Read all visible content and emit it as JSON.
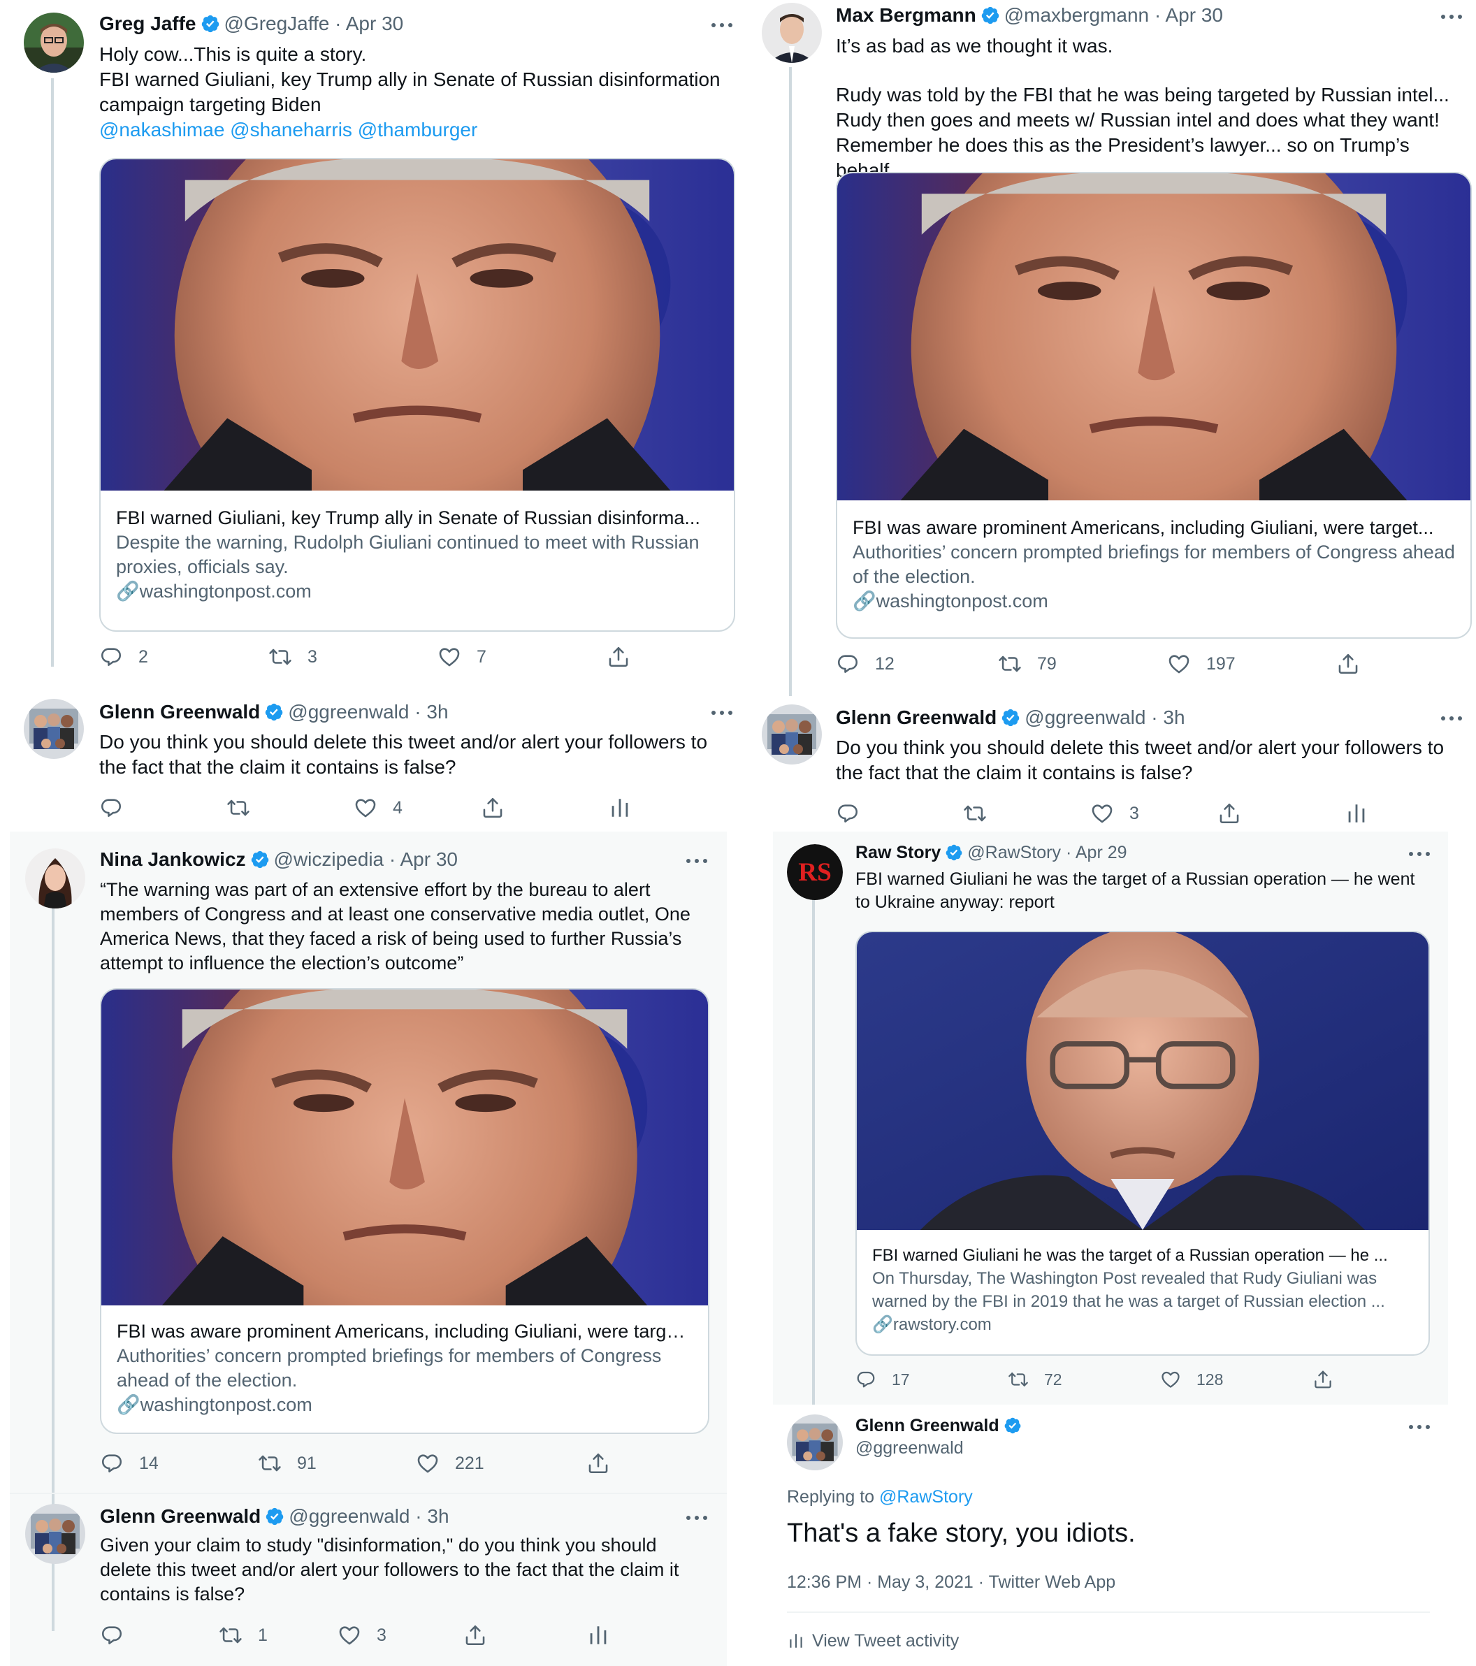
{
  "panels": {
    "top_left": {
      "original": {
        "name": "Greg Jaffe",
        "handle": "@GregJaffe",
        "time": "· Apr 30",
        "text_line1": "Holy cow...This is quite a story.",
        "text_line2": "FBI warned Giuliani, key Trump ally in Senate of Russian disinformation campaign targeting Biden",
        "mentions": "@nakashimae @shaneharris @thamburger",
        "card": {
          "title": "FBI warned Giuliani, key Trump ally in Senate of Russian disinforma...",
          "desc": "Despite the warning, Rudolph Giuliani continued to meet with Russian proxies, officials say.",
          "domain": "washingtonpost.com"
        },
        "replies": "2",
        "retweets": "3",
        "likes": "7"
      },
      "reply": {
        "name": "Glenn Greenwald",
        "handle": "@ggreenwald",
        "time": "· 3h",
        "text": "Do you think you should delete this tweet and/or alert your followers to the fact that the claim it contains is false?",
        "likes": "4"
      }
    },
    "top_right": {
      "original": {
        "name": "Max Bergmann",
        "handle": "@maxbergmann",
        "time": "· Apr 30",
        "text_line1": "It’s as bad as we thought it was.",
        "text_line2": "Rudy was told by the FBI that he was being targeted by Russian intel... Rudy then goes and meets w/ Russian intel and does what they want! Remember he does this as the President’s lawyer... so on Trump’s behalf.",
        "card": {
          "title": "FBI was aware prominent Americans, including Giuliani, were target...",
          "desc": "Authorities’ concern prompted briefings for members of Congress ahead of the election.",
          "domain": "washingtonpost.com"
        },
        "replies": "12",
        "retweets": "79",
        "likes": "197"
      },
      "reply": {
        "name": "Glenn Greenwald",
        "handle": "@ggreenwald",
        "time": "· 3h",
        "text": "Do you think you should delete this tweet and/or alert your followers to the fact that the claim it contains is false?",
        "likes": "3"
      }
    },
    "bottom_left": {
      "original": {
        "name": "Nina Jankowicz",
        "handle": "@wiczipedia",
        "time": "· Apr 30",
        "text": "“The warning was part of an extensive effort by the bureau to alert members of Congress and at least one conservative media outlet, One America News, that they faced a risk of being used to further Russia’s attempt to influence the election’s outcome”",
        "card": {
          "title": "FBI was aware prominent Americans, including Giuliani, were target...",
          "desc": "Authorities’ concern prompted briefings for members of Congress ahead of the election.",
          "domain": "washingtonpost.com"
        },
        "replies": "14",
        "retweets": "91",
        "likes": "221"
      },
      "reply": {
        "name": "Glenn Greenwald",
        "handle": "@ggreenwald",
        "time": "· 3h",
        "text": "Given your claim to study \"disinformation,\" do you think you should delete this tweet and/or alert your followers to the fact that the claim it contains is false?",
        "retweets": "1",
        "likes": "3"
      }
    },
    "bottom_right": {
      "original": {
        "name": "Raw Story",
        "handle": "@RawStory",
        "time": "· Apr 29",
        "text": "FBI warned Giuliani he was the target of a Russian operation — he went to Ukraine anyway: report",
        "card": {
          "title": "FBI warned Giuliani he was the target of a Russian operation — he ...",
          "desc": "On Thursday, The Washington Post revealed that Rudy Giuliani was warned by the FBI in 2019 that he was a target of Russian election ...",
          "domain": "rawstory.com"
        },
        "replies": "17",
        "retweets": "72",
        "likes": "128"
      },
      "reply": {
        "name": "Glenn Greenwald",
        "handle": "@ggreenwald",
        "replying_label": "Replying to",
        "replying_to": "@RawStory",
        "text": "That's a fake story, you idiots.",
        "timestamp": "12:36 PM · May 3, 2021 · Twitter Web App",
        "activity": "View Tweet activity"
      }
    }
  },
  "colors": {
    "accent": "#1d9bf0",
    "text": "#0f1419",
    "secondary": "#536471",
    "border": "#cfd9de",
    "panel_gray": "#f7f9f9"
  }
}
